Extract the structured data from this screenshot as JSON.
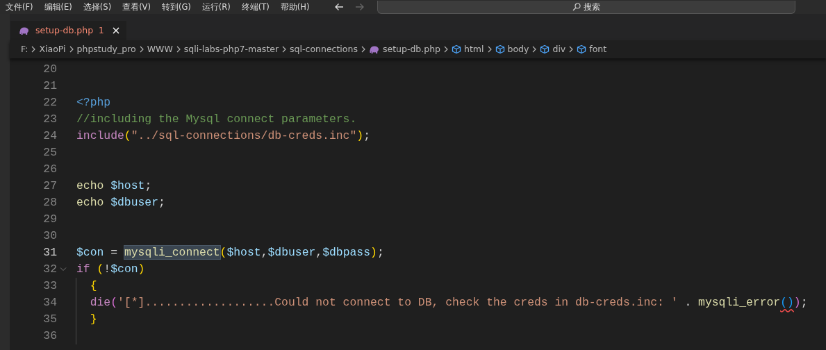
{
  "menu": [
    {
      "label": "文件(F)"
    },
    {
      "label": "编辑(E)"
    },
    {
      "label": "选择(S)"
    },
    {
      "label": "查看(V)"
    },
    {
      "label": "转到(G)"
    },
    {
      "label": "运行(R)"
    },
    {
      "label": "终端(T)"
    },
    {
      "label": "帮助(H)"
    }
  ],
  "nav": {
    "back_disabled": false,
    "forward_disabled": true
  },
  "search": {
    "label": "搜索"
  },
  "tabs": [
    {
      "title": "setup-db.php",
      "problems": "1",
      "selected": true
    }
  ],
  "breadcrumb": [
    {
      "label": "F:",
      "kind": "folder"
    },
    {
      "label": "XiaoPi",
      "kind": "folder"
    },
    {
      "label": "phpstudy_pro",
      "kind": "folder"
    },
    {
      "label": "WWW",
      "kind": "folder"
    },
    {
      "label": "sqli-labs-php7-master",
      "kind": "folder"
    },
    {
      "label": "sql-connections",
      "kind": "folder"
    },
    {
      "label": "setup-db.php",
      "kind": "file"
    },
    {
      "label": "html",
      "kind": "symbol"
    },
    {
      "label": "body",
      "kind": "symbol"
    },
    {
      "label": "div",
      "kind": "symbol"
    },
    {
      "label": "font",
      "kind": "symbol"
    }
  ],
  "code": [
    {
      "number": "20",
      "current": false,
      "foldable": false,
      "guide": false
    },
    {
      "number": "21",
      "current": false,
      "foldable": false,
      "guide": false
    },
    {
      "number": "22",
      "current": false,
      "foldable": false,
      "guide": false,
      "indented": false,
      "tokens": [
        {
          "text": "<?php",
          "kind": "tag",
          "selected": false,
          "squiggle": false
        }
      ]
    },
    {
      "number": "23",
      "current": false,
      "foldable": false,
      "guide": false,
      "indented": false,
      "tokens": [
        {
          "text": "//including the Mysql connect parameters.",
          "kind": "comment",
          "selected": false,
          "squiggle": false
        }
      ]
    },
    {
      "number": "24",
      "current": false,
      "foldable": false,
      "guide": false,
      "indented": false,
      "tokens": [
        {
          "text": "include",
          "kind": "keyword",
          "selected": false,
          "squiggle": false
        },
        {
          "text": "(",
          "kind": "bracket1",
          "selected": false,
          "squiggle": false
        },
        {
          "text": "\"../sql-connections/db-creds.inc\"",
          "kind": "string",
          "selected": false,
          "squiggle": false
        },
        {
          "text": ")",
          "kind": "bracket1",
          "selected": false,
          "squiggle": false
        },
        {
          "text": ";",
          "kind": "plain",
          "selected": false,
          "squiggle": false
        }
      ]
    },
    {
      "number": "25",
      "current": false,
      "foldable": false,
      "guide": false
    },
    {
      "number": "26",
      "current": false,
      "foldable": false,
      "guide": false
    },
    {
      "number": "27",
      "current": false,
      "foldable": false,
      "guide": false,
      "indented": false,
      "tokens": [
        {
          "text": "echo ",
          "kind": "function",
          "selected": false,
          "squiggle": false
        },
        {
          "text": "$host",
          "kind": "variable",
          "selected": false,
          "squiggle": false
        },
        {
          "text": ";",
          "kind": "plain",
          "selected": false,
          "squiggle": false
        }
      ]
    },
    {
      "number": "28",
      "current": false,
      "foldable": false,
      "guide": false,
      "indented": false,
      "tokens": [
        {
          "text": "echo ",
          "kind": "function",
          "selected": false,
          "squiggle": false
        },
        {
          "text": "$dbuser",
          "kind": "variable",
          "selected": false,
          "squiggle": false
        },
        {
          "text": ";",
          "kind": "plain",
          "selected": false,
          "squiggle": false
        }
      ]
    },
    {
      "number": "29",
      "current": false,
      "foldable": false,
      "guide": false
    },
    {
      "number": "30",
      "current": false,
      "foldable": false,
      "guide": false
    },
    {
      "number": "31",
      "current": true,
      "foldable": false,
      "guide": false,
      "indented": false,
      "tokens": [
        {
          "text": "$con",
          "kind": "variable",
          "selected": false,
          "squiggle": false
        },
        {
          "text": " = ",
          "kind": "plain",
          "selected": false,
          "squiggle": false
        },
        {
          "text": "mysqli_connect",
          "kind": "function",
          "selected": true,
          "squiggle": false
        },
        {
          "text": "(",
          "kind": "bracket1",
          "selected": false,
          "squiggle": false
        },
        {
          "text": "$host",
          "kind": "variable",
          "selected": false,
          "squiggle": false
        },
        {
          "text": ",",
          "kind": "plain",
          "selected": false,
          "squiggle": false
        },
        {
          "text": "$dbuser",
          "kind": "variable",
          "selected": false,
          "squiggle": false
        },
        {
          "text": ",",
          "kind": "plain",
          "selected": false,
          "squiggle": false
        },
        {
          "text": "$dbpass",
          "kind": "variable",
          "selected": false,
          "squiggle": false
        },
        {
          "text": ")",
          "kind": "bracket1",
          "selected": false,
          "squiggle": false
        },
        {
          "text": ";",
          "kind": "plain",
          "selected": false,
          "squiggle": false
        }
      ]
    },
    {
      "number": "32",
      "current": false,
      "foldable": true,
      "guide": false,
      "indented": false,
      "tokens": [
        {
          "text": "if ",
          "kind": "keyword",
          "selected": false,
          "squiggle": false
        },
        {
          "text": "(",
          "kind": "bracket1",
          "selected": false,
          "squiggle": false
        },
        {
          "text": "!",
          "kind": "plain",
          "selected": false,
          "squiggle": false
        },
        {
          "text": "$con",
          "kind": "variable",
          "selected": false,
          "squiggle": false
        },
        {
          "text": ")",
          "kind": "bracket1",
          "selected": false,
          "squiggle": false
        }
      ]
    },
    {
      "number": "33",
      "current": false,
      "foldable": false,
      "guide": true,
      "indented": true,
      "tokens": [
        {
          "text": "{",
          "kind": "bracket1",
          "selected": false,
          "squiggle": false
        }
      ]
    },
    {
      "number": "34",
      "current": false,
      "foldable": false,
      "guide": true,
      "indented": true,
      "tokens": [
        {
          "text": "die",
          "kind": "keyword",
          "selected": false,
          "squiggle": false
        },
        {
          "text": "(",
          "kind": "bracket2",
          "selected": false,
          "squiggle": false
        },
        {
          "text": "'[*]...................Could not connect to DB, check the creds in db-creds.inc: '",
          "kind": "string",
          "selected": false,
          "squiggle": false
        },
        {
          "text": " . ",
          "kind": "plain",
          "selected": false,
          "squiggle": false
        },
        {
          "text": "mysqli_error",
          "kind": "function",
          "selected": false,
          "squiggle": false
        },
        {
          "text": "()",
          "kind": "bracket3",
          "selected": false,
          "squiggle": true
        },
        {
          "text": ")",
          "kind": "bracket2",
          "selected": false,
          "squiggle": false
        },
        {
          "text": ";",
          "kind": "plain",
          "selected": false,
          "squiggle": false
        }
      ]
    },
    {
      "number": "35",
      "current": false,
      "foldable": false,
      "guide": true,
      "indented": true,
      "tokens": [
        {
          "text": "}",
          "kind": "bracket1",
          "selected": false,
          "squiggle": false
        }
      ]
    },
    {
      "number": "36",
      "current": false,
      "foldable": false,
      "guide": true
    }
  ]
}
